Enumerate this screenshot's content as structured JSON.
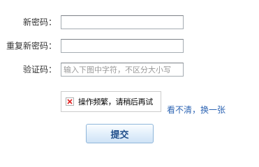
{
  "form": {
    "new_password": {
      "label": "新密码：",
      "value": "",
      "placeholder": ""
    },
    "confirm_password": {
      "label": "重复新密码：",
      "value": "",
      "placeholder": ""
    },
    "captcha": {
      "label": "验证码：",
      "value": "",
      "placeholder": "输入下图中字符，不区分大小写",
      "image_alt": "操作频繁，请稍后再试",
      "image_icon": "broken-image-icon",
      "refresh_link": "看不清，换一张"
    },
    "submit_label": "提交"
  },
  "colors": {
    "link": "#2d64b3",
    "button_text": "#1f4d8a",
    "button_border": "#8fb6da",
    "field_border": "#a5acb2",
    "placeholder": "#999999"
  }
}
